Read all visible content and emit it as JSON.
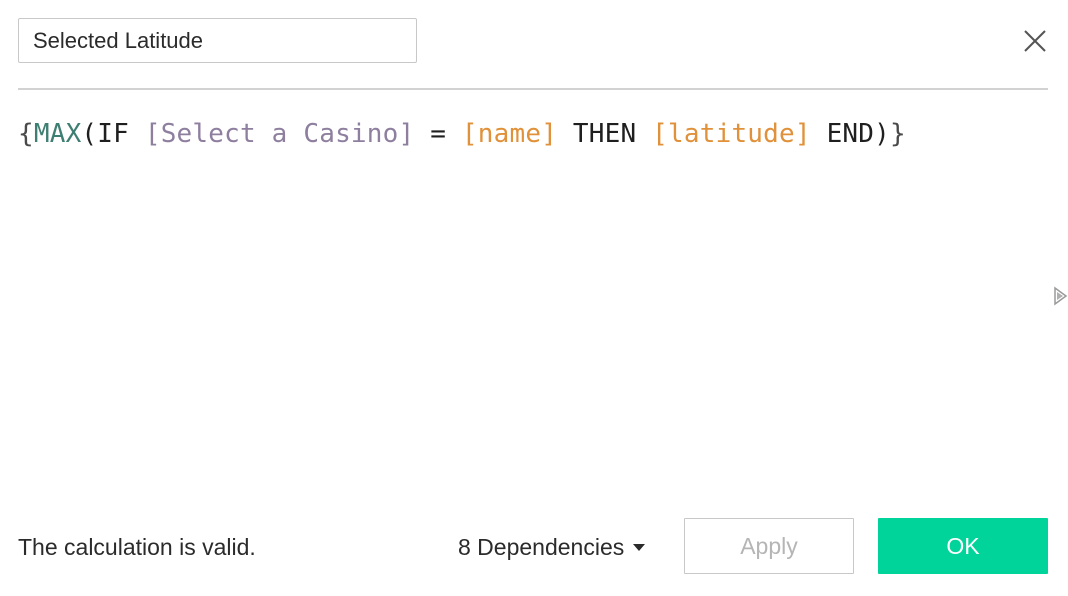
{
  "name_field": {
    "value": "Selected Latitude"
  },
  "formula": {
    "tokens": [
      {
        "text": "{",
        "kind": "brace"
      },
      {
        "text": "MAX",
        "kind": "func"
      },
      {
        "text": "(IF ",
        "kind": "kw"
      },
      {
        "text": "[Select a Casino]",
        "kind": "param"
      },
      {
        "text": " = ",
        "kind": "op"
      },
      {
        "text": "[name]",
        "kind": "field"
      },
      {
        "text": " THEN ",
        "kind": "kw"
      },
      {
        "text": "[latitude]",
        "kind": "field"
      },
      {
        "text": " END)",
        "kind": "kw"
      },
      {
        "text": "}",
        "kind": "brace"
      }
    ]
  },
  "footer": {
    "status": "The calculation is valid.",
    "dependencies_label": "8 Dependencies",
    "apply_label": "Apply",
    "ok_label": "OK"
  },
  "icons": {
    "close": "close-icon",
    "dependencies_caret": "caret-down-icon",
    "side_panel": "caret-right-icon"
  },
  "colors": {
    "ok_button": "#00d49a",
    "function_token": "#3f7f73",
    "parameter_token": "#8e7f9f",
    "field_token": "#e0913a"
  }
}
